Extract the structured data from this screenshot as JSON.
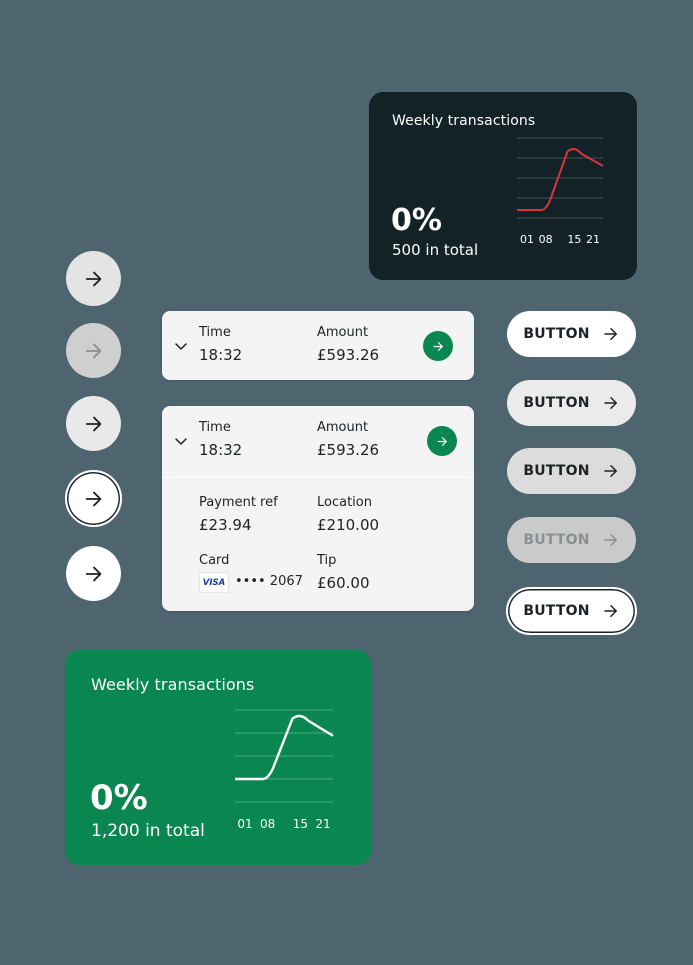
{
  "colors": {
    "page_bg": "#4e6570",
    "dark_card": "#132227",
    "green": "#0a8750",
    "red_line": "#d8353b"
  },
  "chart_dark": {
    "title": "Weekly transactions",
    "percent": "0%",
    "total": "500 in total",
    "chart_data": {
      "type": "line",
      "categories": [
        "01",
        "08",
        "15",
        "21"
      ],
      "series": [
        {
          "values": [
            0.1,
            0.1,
            0.88,
            0.65
          ],
          "color": "#d8353b"
        }
      ],
      "grid": true,
      "ylim": [
        0,
        1
      ]
    }
  },
  "chart_green": {
    "title": "Weekly transactions",
    "percent": "0%",
    "total": "1,200 in total",
    "chart_data": {
      "type": "line",
      "categories": [
        "01",
        "08",
        "15",
        "21"
      ],
      "series": [
        {
          "values": [
            0.25,
            0.25,
            0.95,
            0.72
          ],
          "color": "#ffffff"
        }
      ],
      "grid": true,
      "ylim": [
        0,
        1
      ]
    }
  },
  "icons": {
    "circle_buttons": [
      "arrow-right-icon",
      "arrow-right-icon",
      "arrow-right-icon",
      "arrow-right-icon",
      "arrow-right-icon"
    ],
    "row_action": "arrow-right-icon",
    "expand": "chevron-down-icon",
    "card_brand": "visa-logo"
  },
  "transaction_collapsed": {
    "time_label": "Time",
    "time_value": "18:32",
    "amount_label": "Amount",
    "amount_value": "£593.26"
  },
  "transaction_expanded": {
    "time_label": "Time",
    "time_value": "18:32",
    "amount_label": "Amount",
    "amount_value": "£593.26",
    "payment_ref_label": "Payment ref",
    "payment_ref_value": "£23.94",
    "location_label": "Location",
    "location_value": "£210.00",
    "card_label": "Card",
    "card_brand": "VISA",
    "card_number": "•••• 2067",
    "tip_label": "Tip",
    "tip_value": "£60.00"
  },
  "buttons": {
    "labels": [
      "BUTTON",
      "BUTTON",
      "BUTTON",
      "BUTTON",
      "BUTTON"
    ]
  }
}
